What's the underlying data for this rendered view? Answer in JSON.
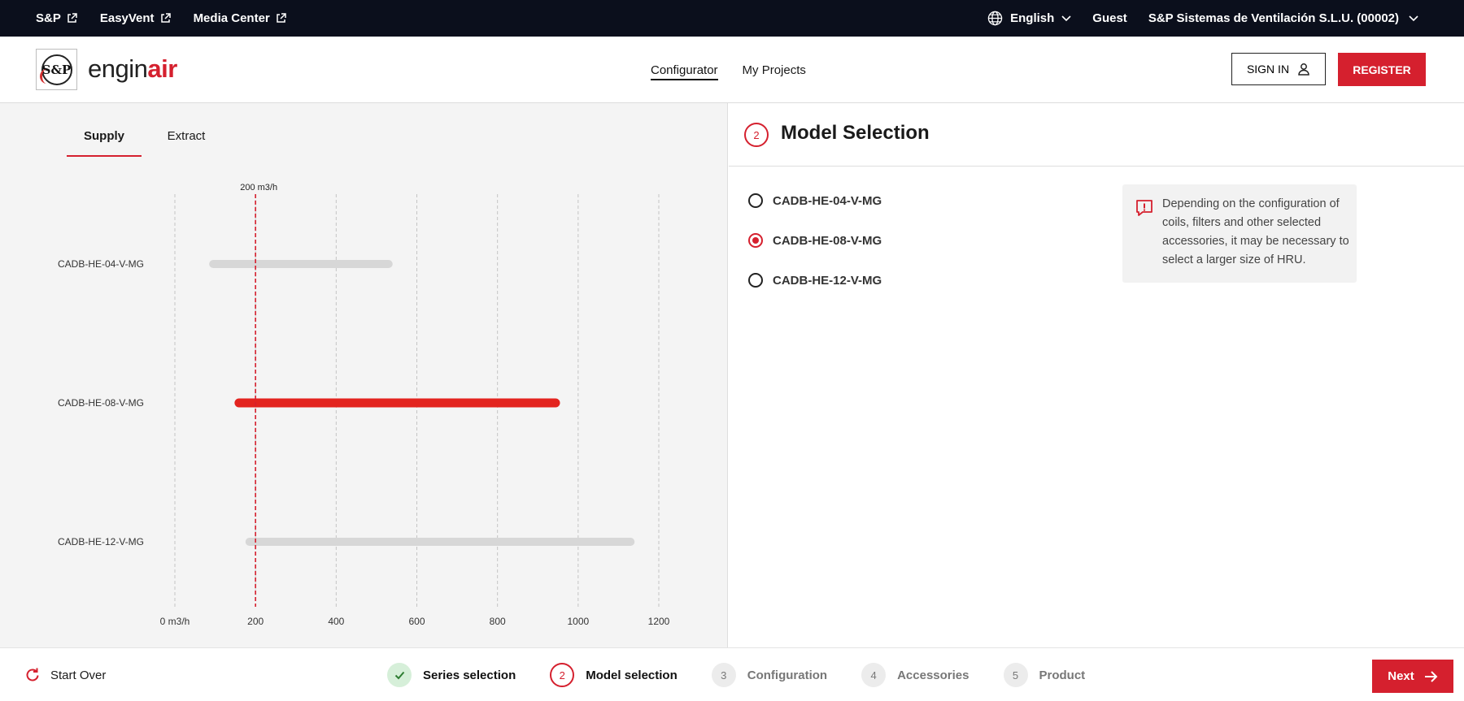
{
  "topbar": {
    "links": [
      {
        "label": "S&P"
      },
      {
        "label": "EasyVent"
      },
      {
        "label": "Media Center"
      }
    ],
    "language": "English",
    "user": "Guest",
    "company": "S&P Sistemas de Ventilación S.L.U. (00002)"
  },
  "header": {
    "logo_text": "S&P",
    "brand_prefix": "engin",
    "brand_suffix": "air",
    "nav": [
      {
        "label": "Configurator",
        "active": true
      },
      {
        "label": "My Projects",
        "active": false
      }
    ],
    "signin_label": "SIGN IN",
    "register_label": "REGISTER"
  },
  "left": {
    "tabs": [
      {
        "label": "Supply",
        "active": true
      },
      {
        "label": "Extract",
        "active": false
      }
    ]
  },
  "chart_data": {
    "type": "range-bar",
    "x_ticks": [
      "0 m3/h",
      "200",
      "400",
      "600",
      "800",
      "1000",
      "1200"
    ],
    "x_tick_values": [
      0,
      200,
      400,
      600,
      800,
      1000,
      1200
    ],
    "xlim": [
      0,
      1200
    ],
    "grid": true,
    "reference_line": {
      "value": 200,
      "label": "200 m3/h",
      "color": "#d5202e"
    },
    "series": [
      {
        "category": "CADB-HE-04-V-MG",
        "min": 85,
        "max": 540,
        "selected": false
      },
      {
        "category": "CADB-HE-08-V-MG",
        "min": 148,
        "max": 955,
        "selected": true
      },
      {
        "category": "CADB-HE-12-V-MG",
        "min": 175,
        "max": 1140,
        "selected": false
      }
    ],
    "colors": {
      "selected": "#e3241f",
      "unselected": "#d7d7d7",
      "grid": "#c4c4c4"
    }
  },
  "right": {
    "step_number": "2",
    "title": "Model Selection",
    "models": [
      {
        "label": "CADB-HE-04-V-MG",
        "selected": false
      },
      {
        "label": "CADB-HE-08-V-MG",
        "selected": true
      },
      {
        "label": "CADB-HE-12-V-MG",
        "selected": false
      }
    ],
    "notice": "Depending on the configuration of coils, filters and other selected accessories, it may be necessary to select a larger size of HRU."
  },
  "bottom": {
    "start_over": "Start Over",
    "steps": [
      {
        "number": "",
        "label": "Series selection",
        "state": "done"
      },
      {
        "number": "2",
        "label": "Model selection",
        "state": "current"
      },
      {
        "number": "3",
        "label": "Configuration",
        "state": "todo"
      },
      {
        "number": "4",
        "label": "Accessories",
        "state": "todo"
      },
      {
        "number": "5",
        "label": "Product",
        "state": "todo"
      }
    ],
    "next_label": "Next"
  },
  "colors": {
    "accent": "#d5202e",
    "topbar": "#0b0f1c",
    "panel_bg": "#f4f4f4"
  }
}
